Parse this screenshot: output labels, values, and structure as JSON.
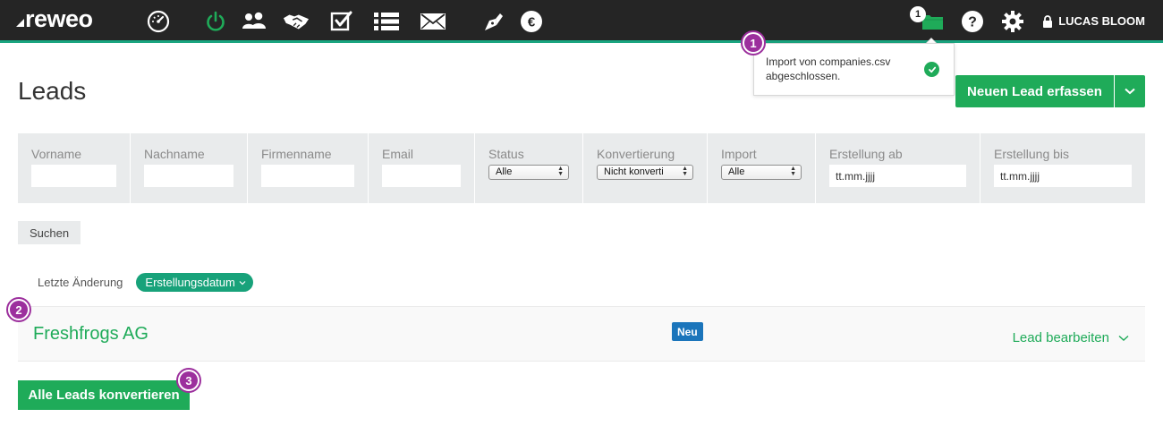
{
  "app": {
    "logo": "reweo"
  },
  "topbar": {
    "nav_icons": [
      "dashboard-icon",
      "power-icon",
      "contacts-icon",
      "handshake-icon",
      "tasks-icon",
      "list-icon",
      "mail-icon",
      "pen-icon",
      "euro-icon"
    ],
    "active_color": "#1fab59",
    "accent_line": "#1aa580",
    "folder_badge": "1",
    "user_name": "LUCAS BLOOM"
  },
  "notification": {
    "message": "Import von companies.csv abgeschlossen."
  },
  "page": {
    "title": "Leads",
    "new_lead_label": "Neuen Lead erfassen"
  },
  "filters": {
    "vorname": {
      "label": "Vorname",
      "value": ""
    },
    "nachname": {
      "label": "Nachname",
      "value": ""
    },
    "firmenname": {
      "label": "Firmenname",
      "value": ""
    },
    "email": {
      "label": "Email",
      "value": ""
    },
    "status": {
      "label": "Status",
      "selected": "Alle"
    },
    "konvertierung": {
      "label": "Konvertierung",
      "selected": "Nicht konverti"
    },
    "import": {
      "label": "Import",
      "selected": "Alle"
    },
    "erstellung_ab": {
      "label": "Erstellung ab",
      "value": "tt.mm.jjjj"
    },
    "erstellung_bis": {
      "label": "Erstellung bis",
      "value": "tt.mm.jjjj"
    }
  },
  "search_label": "Suchen",
  "sort": {
    "label": "Letzte Änderung",
    "active": "Erstellungsdatum"
  },
  "leads": [
    {
      "name": "Freshfrogs AG",
      "badge": "Neu",
      "action": "Lead bearbeiten"
    }
  ],
  "convert_all_label": "Alle Leads konvertieren",
  "markers": [
    "1",
    "2",
    "3"
  ],
  "colors": {
    "primary_green": "#1fab59",
    "teal": "#18a27a",
    "badge_blue": "#1b75bb",
    "marker_purple": "#9c2f9d"
  }
}
